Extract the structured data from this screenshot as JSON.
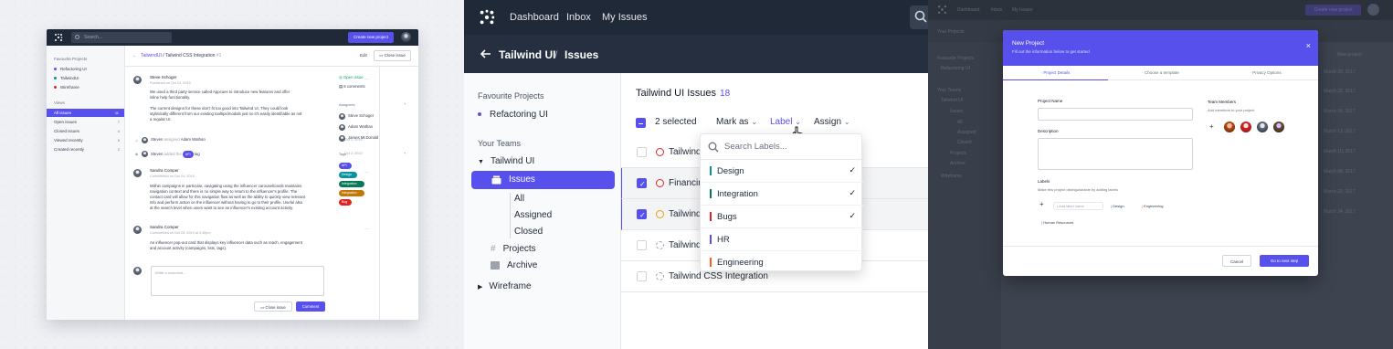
{
  "paneA": {
    "search_placeholder": "Search...",
    "create_button": "Create new project",
    "sidebar": {
      "favourite_heading": "Favourite Projects",
      "favourites": [
        {
          "label": "Refactoring UI",
          "color": "#5850ec"
        },
        {
          "label": "TailwindUI",
          "color": "#0e9f6e"
        },
        {
          "label": "Wireframe",
          "color": "#e02424"
        }
      ],
      "views_heading": "Views",
      "views": [
        {
          "label": "All issues",
          "count": "11"
        },
        {
          "label": "Open issues",
          "count": "7"
        },
        {
          "label": "Closed issues",
          "count": "4"
        },
        {
          "label": "Viewed recently",
          "count": "5"
        },
        {
          "label": "Created recently",
          "count": "2"
        }
      ]
    },
    "breadcrumb": {
      "project": "TailwindUI",
      "sep": "/",
      "issue": "Tailwind CSS Integration",
      "num": "#1"
    },
    "edit_label": "Edit",
    "close_issue_label": "Close issue",
    "comments": [
      {
        "author": "Steve Schoger",
        "meta": "Published on Oct 23, 2019",
        "p1": "We used a third party service called Appcues to introduce new features and offer",
        "p1b": "inline help functionality.",
        "p2": "The current designs for these don't fit too good into Tailwind UI. They could look",
        "p2b": "stylistically different from our existing tooltips/modals just so it's easily identifiable as not",
        "p2c": "a regular UI."
      },
      {
        "author": "Sandra Comper",
        "meta": "Commented on Oct 24, 2019",
        "p1": "Within campaigns in particular, navigating using the influencer carousel/cards maintains",
        "p1b": "navigation context and there is no simple way to return to the influencer's profile. The",
        "p1c": "contact card will allow for this navigation flow as well as the ability to quickly view relevant",
        "p1d": "info and perform action on the influencer without having to go to their profile. Useful also",
        "p1e": "at the search level when users want to see an influencer's existing account activity."
      },
      {
        "author": "Sandra Comper",
        "meta": "Commented on Oct 25, 2019 at 2:30pm",
        "p1": "An influencer pop-out card that displays key influencer data such as reach, engagement",
        "p1b": "and account activity (campaigns, lists, tags)."
      }
    ],
    "activity": [
      {
        "actor": "Steven",
        "verb": "assigned",
        "target": "Adam Wathan",
        "date": "Oct 2, 2019"
      },
      {
        "actor": "Steven",
        "verb": "added the",
        "tag": "API",
        "suffix": "tag",
        "date": "Oct 2, 2019"
      }
    ],
    "comment_placeholder": "Write a comment...",
    "close_issue_button": "Close issue",
    "comment_button": "Comment",
    "right": {
      "status": "Open issue",
      "comments_count": "6 comments",
      "assignees_heading": "Assignees",
      "assignees": [
        "Steve Schoger",
        "Adam Wathan",
        "James McDonald"
      ],
      "tags_heading": "Tags",
      "tags": [
        {
          "label": "API",
          "color": "#5850ec"
        },
        {
          "label": "Design",
          "color": "#0694a2"
        },
        {
          "label": "Integration",
          "color": "#057a55"
        },
        {
          "label": "Integration",
          "color": "#c27803"
        },
        {
          "label": "Bug",
          "color": "#e02424"
        }
      ]
    }
  },
  "paneB": {
    "nav": [
      "Dashboard",
      "Inbox",
      "My Issues"
    ],
    "project": "Tailwind UI",
    "sep": "/",
    "section": "Issues",
    "sidebar": {
      "favourite_heading": "Favourite Projects",
      "favourite": "Refactoring UI",
      "teams_heading": "Your Teams",
      "team": "Tailwind UI",
      "issues": "Issues",
      "sub": [
        "All",
        "Assigned",
        "Closed"
      ],
      "projects": "Projects",
      "archive": "Archive",
      "wireframe": "Wireframe"
    },
    "main_title": "Tailwind UI Issues",
    "main_count": "18",
    "toolbar": {
      "selected": "2 selected",
      "mark_as": "Mark as",
      "label": "Label",
      "assign": "Assign"
    },
    "rows": [
      {
        "text": "Tailwind",
        "checked": false,
        "ring": "#e02424"
      },
      {
        "text": "Financin",
        "checked": true,
        "ring": "#e02424"
      },
      {
        "text": "Tailwind",
        "checked": true,
        "ring": "#e3a008"
      },
      {
        "text": "Tailwind",
        "checked": false,
        "ring": "#9ca3af"
      },
      {
        "text": "Tailwind CSS Integration",
        "checked": false,
        "ring": "#9ca3af"
      }
    ],
    "dropdown": {
      "placeholder": "Search Labels...",
      "items": [
        {
          "label": "Design",
          "color": "#0694a2",
          "checked": true
        },
        {
          "label": "Integration",
          "color": "#057a55",
          "checked": true
        },
        {
          "label": "Bugs",
          "color": "#e02424",
          "checked": true
        },
        {
          "label": "HR",
          "color": "#5850ec",
          "checked": false
        },
        {
          "label": "Engineering",
          "color": "#ff5a1f",
          "checked": false
        }
      ]
    }
  },
  "paneC": {
    "bg": {
      "nav": [
        "Dashboard",
        "Inbox",
        "My Issues"
      ],
      "create": "Create new project",
      "title": "Your Projects",
      "sidebar": [
        "Favourite Projects",
        "Refactoring UI",
        "Your Teams",
        "Tailwind UI",
        "Issues",
        "All",
        "Assigned",
        "Closed",
        "Projects",
        "Archive",
        "Wireframe"
      ],
      "new_project": "New project",
      "dates": [
        "March 20, 2017",
        "March 22, 2017",
        "March 16, 2017",
        "March 13, 2017",
        "March 10, 2017",
        "March 08, 2017",
        "March 22, 2017",
        "March 24, 2017"
      ]
    },
    "modal": {
      "title": "New Project",
      "subtitle": "Fill out the information below to get started",
      "tabs": [
        "Project Details",
        "Choose a template",
        "Privacy Options"
      ],
      "project_name_label": "Project Name",
      "description_label": "Description",
      "team_members_label": "Team Members",
      "team_members_help": "Add members to your project",
      "labels_label": "Labels",
      "labels_help": "Make this project distinguishable by adding labels",
      "add_label_placeholder": "Add label name",
      "chips": [
        "Design",
        "Engineering",
        "Human Resources"
      ],
      "cancel": "Cancel",
      "next": "Go to next step"
    }
  }
}
